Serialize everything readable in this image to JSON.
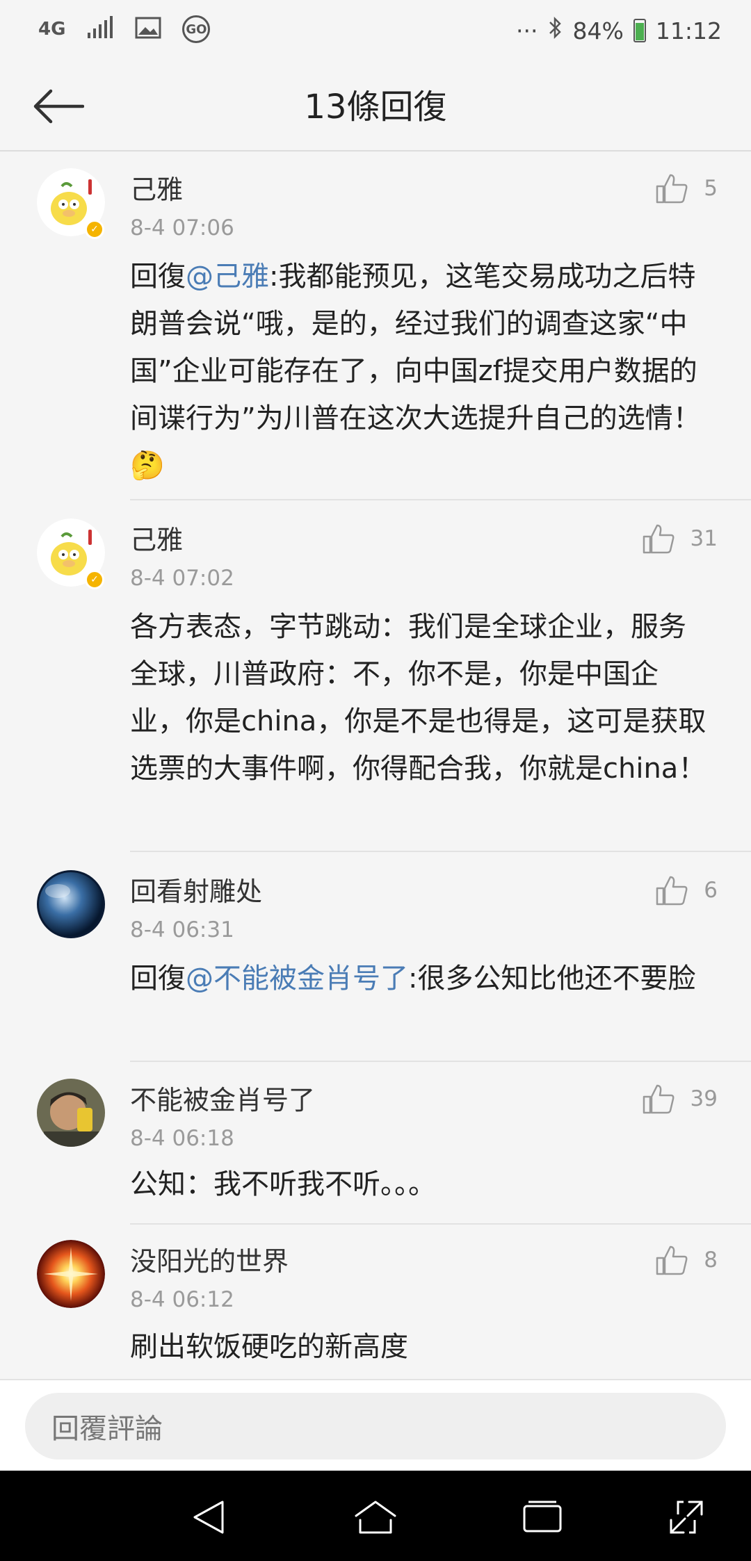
{
  "status_bar": {
    "network": "4G",
    "go_label": "GO",
    "more": "···",
    "battery_percent": "84%",
    "battery_level": 0.84,
    "time": "11:12"
  },
  "header": {
    "title": "13條回復"
  },
  "comments": [
    {
      "username": "己雅",
      "time": "8-4 07:06",
      "likes": "5",
      "reply_prefix": "回復",
      "mention": "@己雅",
      "text": ":我都能预见，这笔交易成功之后特朗普会说“哦，是的，经过我们的调查这家“中国”企业可能存在了，向中国zf提交用户数据的间谍行为”为川普在这次大选提升自己的选情！",
      "emoji": "🤔"
    },
    {
      "username": "己雅",
      "time": "8-4 07:02",
      "likes": "31",
      "text": "各方表态，字节跳动：我们是全球企业，服务全球，川普政府：不，你不是，你是中国企业，你是china，你是不是也得是，这可是获取选票的大事件啊，你得配合我，你就是china！"
    },
    {
      "username": "回看射雕处",
      "time": "8-4 06:31",
      "likes": "6",
      "reply_prefix": "回復",
      "mention": "@不能被金肖号了",
      "text": ":很多公知比他还不要脸"
    },
    {
      "username": "不能被金肖号了",
      "time": "8-4 06:18",
      "likes": "39",
      "text": "公知：我不听我不听。。。"
    },
    {
      "username": "没阳光的世界",
      "time": "8-4 06:12",
      "likes": "8",
      "text": "刷出软饭硬吃的新高度"
    }
  ],
  "reply_bar": {
    "placeholder": "回覆評論"
  },
  "colors": {
    "mention": "#4a7cb5",
    "verified_badge": "#f5b400",
    "background": "#f5f5f5"
  }
}
